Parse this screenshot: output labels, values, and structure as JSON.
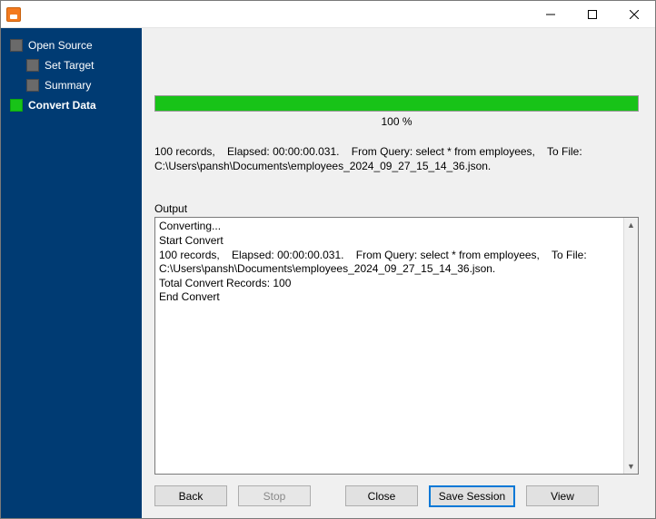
{
  "window": {
    "title": ""
  },
  "sidebar": {
    "items": [
      {
        "label": "Open Source"
      },
      {
        "label": "Set Target"
      },
      {
        "label": "Summary"
      },
      {
        "label": "Convert Data"
      }
    ]
  },
  "progress": {
    "percent_text": "100 %"
  },
  "summary_text": "100 records,    Elapsed: 00:00:00.031.    From Query: select * from employees,    To File: C:\\Users\\pansh\\Documents\\employees_2024_09_27_15_14_36.json.",
  "output": {
    "label": "Output",
    "text": "Converting...\nStart Convert\n100 records,    Elapsed: 00:00:00.031.    From Query: select * from employees,    To File: C:\\Users\\pansh\\Documents\\employees_2024_09_27_15_14_36.json.\nTotal Convert Records: 100\nEnd Convert"
  },
  "buttons": {
    "back": "Back",
    "stop": "Stop",
    "close": "Close",
    "save_session": "Save Session",
    "view": "View"
  }
}
